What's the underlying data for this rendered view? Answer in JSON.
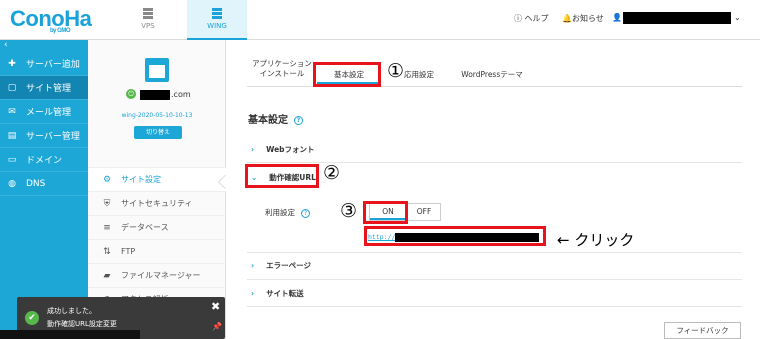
{
  "brand": {
    "logo": "ConoHa",
    "sub": "by GMO"
  },
  "topnav": [
    {
      "label": "VPS"
    },
    {
      "label": "WING"
    }
  ],
  "header": {
    "help": "ヘルプ",
    "notice": "お知らせ"
  },
  "sidebar": {
    "collapse": "‹",
    "items": [
      {
        "icon": "plus-icon",
        "label": "サーバー追加"
      },
      {
        "icon": "window-icon",
        "label": "サイト管理"
      },
      {
        "icon": "mail-icon",
        "label": "メール管理"
      },
      {
        "icon": "server-icon",
        "label": "サーバー管理"
      },
      {
        "icon": "domain-icon",
        "label": "ドメイン"
      },
      {
        "icon": "globe-icon",
        "label": "DNS"
      }
    ]
  },
  "server": {
    "domain_suffix": ".com",
    "name": "wing-2020-05-10-10-13",
    "switch_label": "切り替え"
  },
  "subnav": [
    {
      "icon": "site-settings-icon",
      "label": "サイト設定"
    },
    {
      "icon": "shield-icon",
      "label": "サイトセキュリティ"
    },
    {
      "icon": "database-icon",
      "label": "データベース"
    },
    {
      "icon": "ftp-icon",
      "label": "FTP"
    },
    {
      "icon": "folder-icon",
      "label": "ファイルマネージャー"
    },
    {
      "icon": "chart-icon",
      "label": "アクセス解析"
    }
  ],
  "tabs": [
    {
      "label": "アプリケーション\nインストール"
    },
    {
      "label": "基本設定"
    },
    {
      "label": "応用設定"
    },
    {
      "label": "WordPressテーマ"
    }
  ],
  "section_title": "基本設定",
  "accordions": [
    {
      "label": "Webフォント"
    },
    {
      "label": "動作確認URL"
    },
    {
      "label": "エラーページ"
    },
    {
      "label": "サイト転送"
    }
  ],
  "setting": {
    "label": "利用設定",
    "on": "ON",
    "off": "OFF"
  },
  "url": {
    "prefix": "http://"
  },
  "annotations": {
    "n1": "①",
    "n2": "②",
    "n3": "③",
    "click": "← クリック"
  },
  "feedback": "フィードバック",
  "toast": {
    "line1": "成功しました。",
    "line2": "動作確認URL設定変更"
  },
  "colors": {
    "accent": "#1da7d6",
    "annotation_red": "#e8141b",
    "success": "#56b84a"
  }
}
